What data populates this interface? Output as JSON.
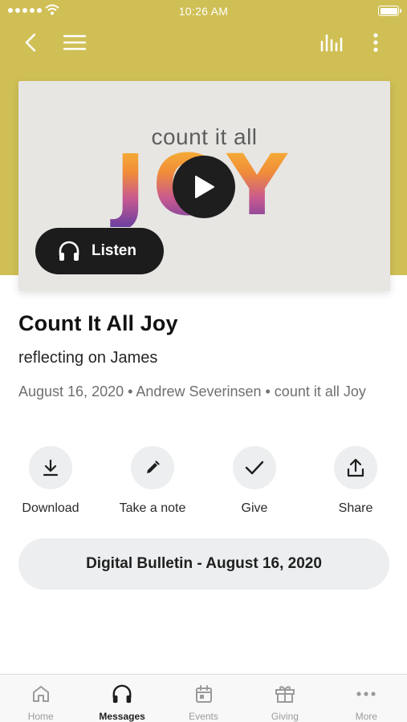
{
  "status_bar": {
    "time": "10:26 AM"
  },
  "nav": {
    "back_icon": "chevron-left-icon",
    "menu_icon": "hamburger-icon",
    "queue_icon": "equalizer-icon",
    "more_icon": "vertical-dots-icon"
  },
  "colors": {
    "hero_background": "#cfbf55",
    "dark_button": "#1c1c1c",
    "soft_button": "#eceeef"
  },
  "artwork": {
    "subtitle": "count it all",
    "title": "JOY"
  },
  "listen_button": {
    "label": "Listen",
    "icon": "headphones-icon"
  },
  "message": {
    "title": "Count It All Joy",
    "subtitle": "reflecting on James",
    "meta": "August 16, 2020 • Andrew Severinsen • count it all Joy"
  },
  "actions": [
    {
      "label": "Download",
      "icon": "download-icon"
    },
    {
      "label": "Take a note",
      "icon": "pencil-icon"
    },
    {
      "label": "Give",
      "icon": "check-icon"
    },
    {
      "label": "Share",
      "icon": "share-icon"
    }
  ],
  "bulletin_button": {
    "label": "Digital Bulletin - August 16, 2020"
  },
  "tabs": [
    {
      "label": "Home",
      "icon": "home-icon",
      "active": false
    },
    {
      "label": "Messages",
      "icon": "headphones-icon",
      "active": true
    },
    {
      "label": "Events",
      "icon": "calendar-icon",
      "active": false
    },
    {
      "label": "Giving",
      "icon": "gift-icon",
      "active": false
    },
    {
      "label": "More",
      "icon": "more-dots-icon",
      "active": false
    }
  ]
}
